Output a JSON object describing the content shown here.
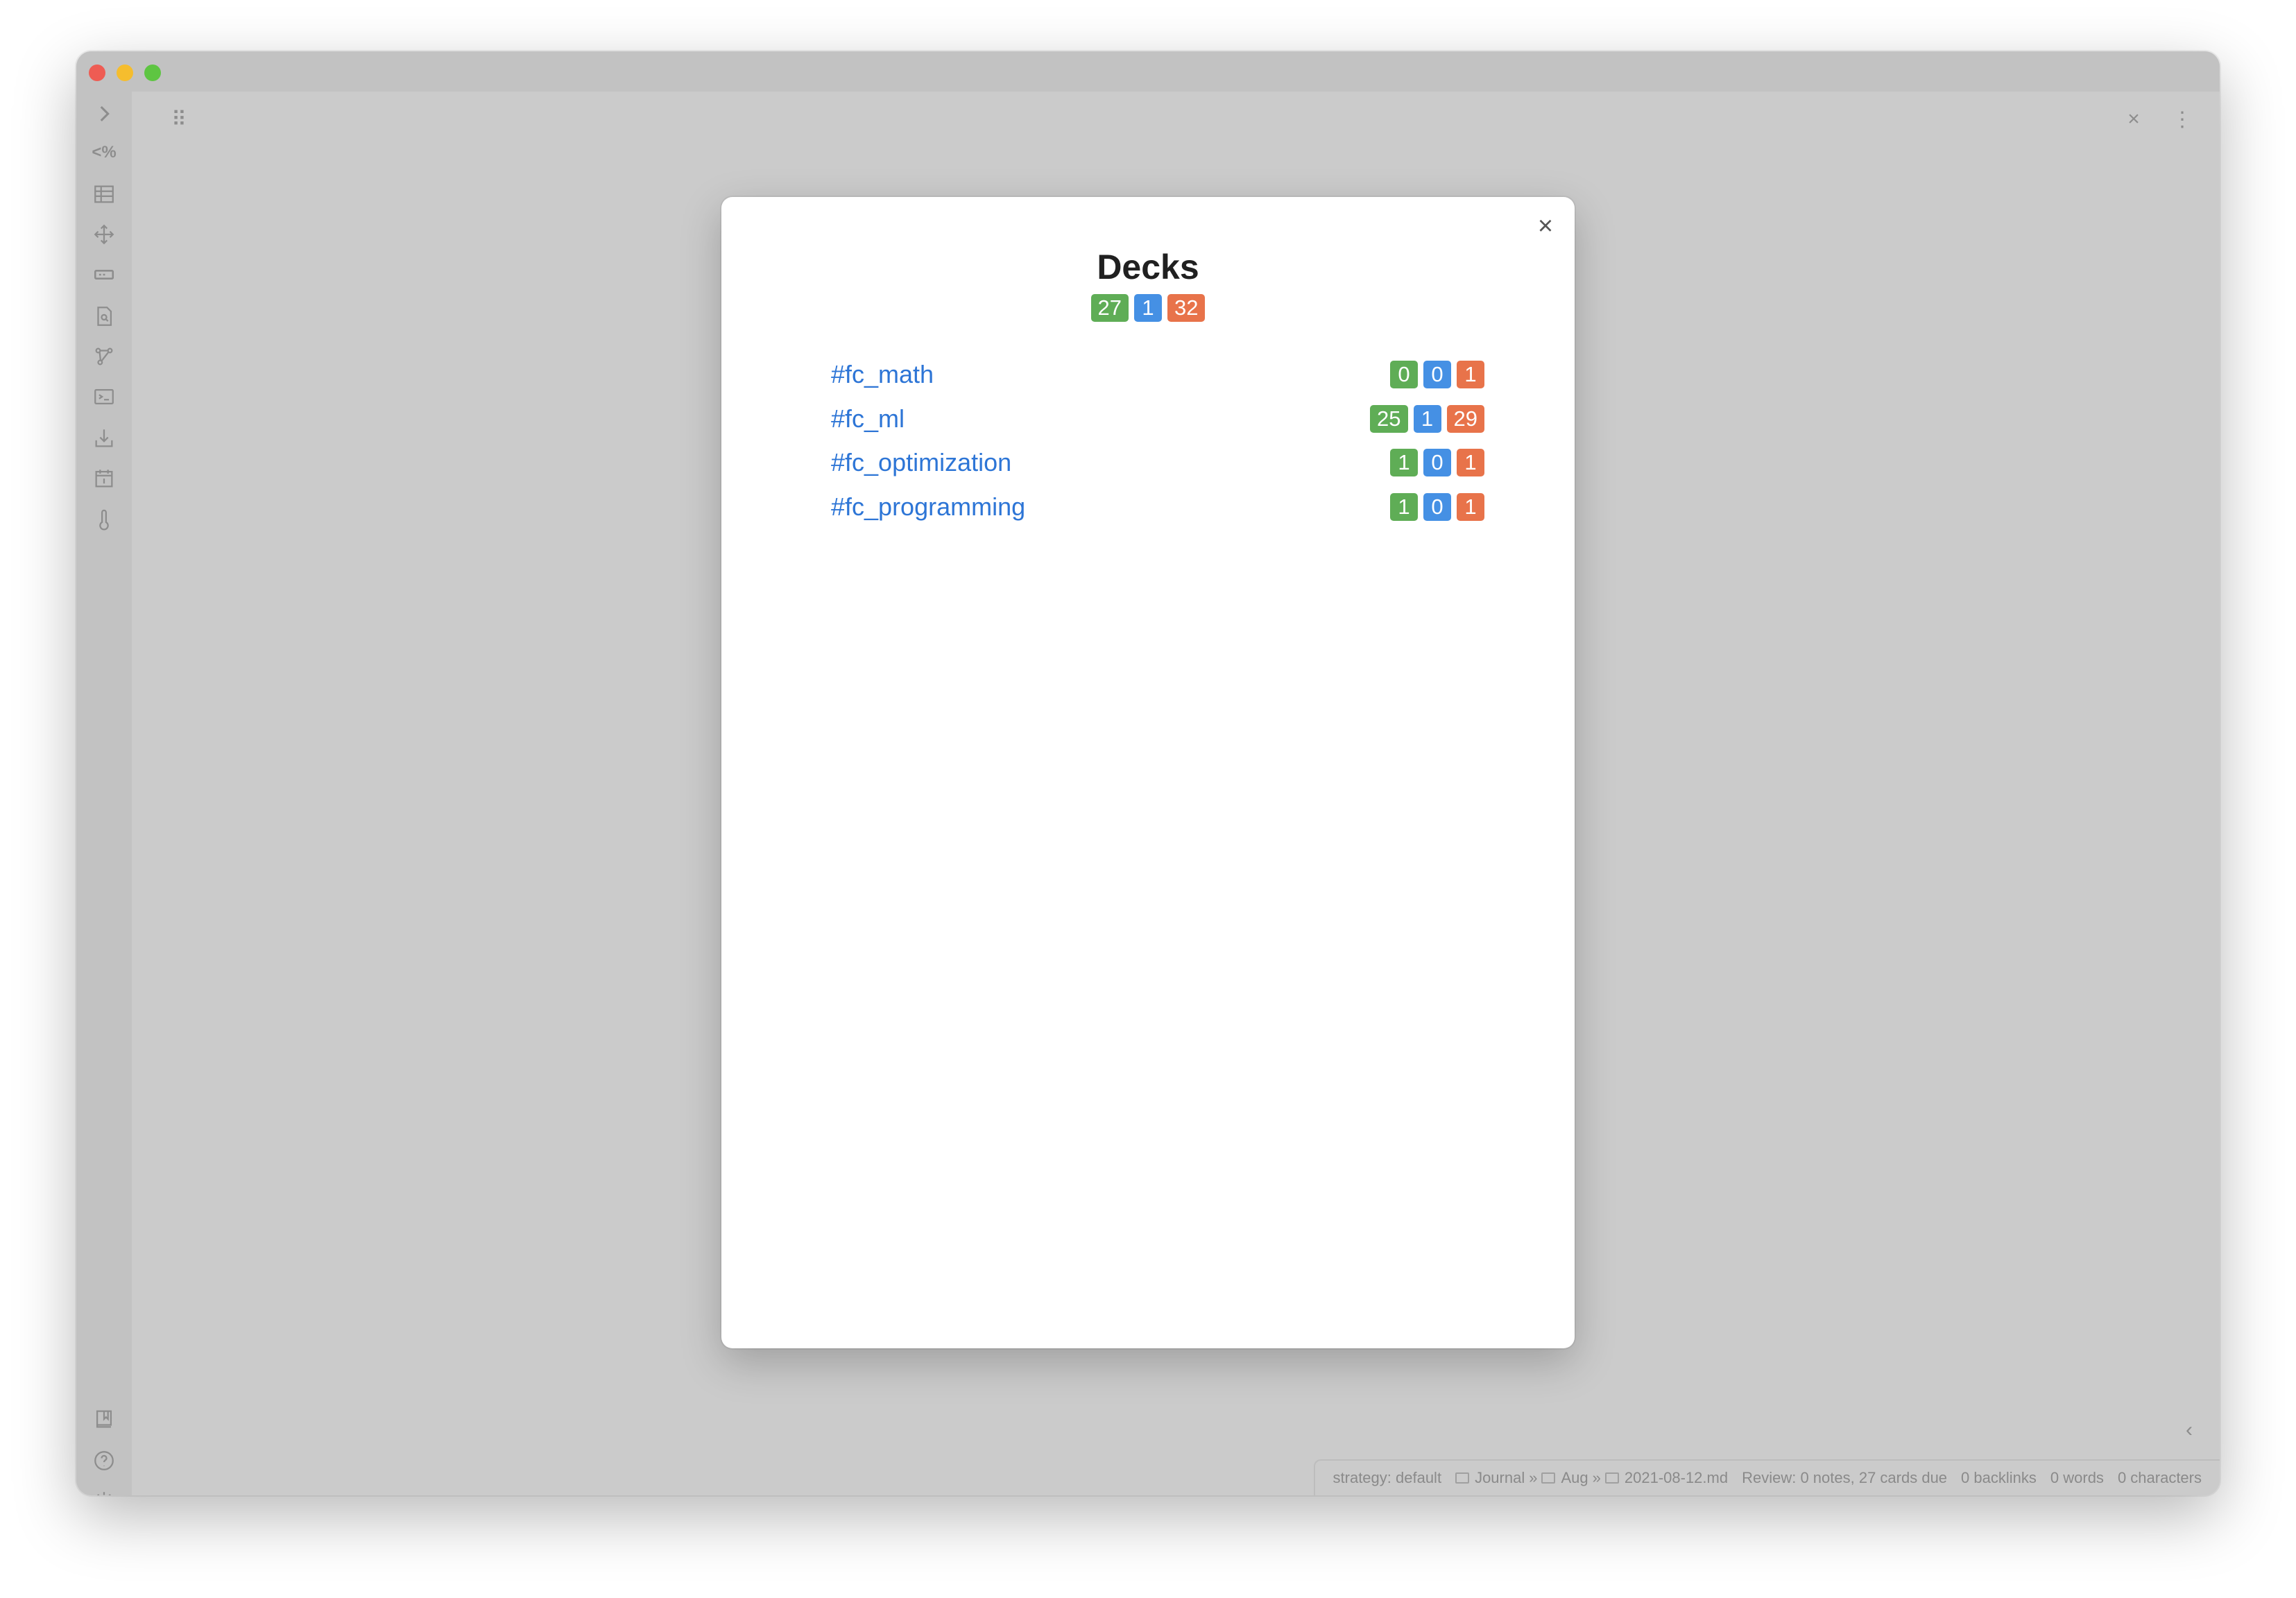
{
  "modal": {
    "title": "Decks",
    "close_glyph": "×",
    "summary": {
      "new": "27",
      "learning": "1",
      "due": "32"
    },
    "decks": [
      {
        "name": "#fc_math",
        "new": "0",
        "learning": "0",
        "due": "1"
      },
      {
        "name": "#fc_ml",
        "new": "25",
        "learning": "1",
        "due": "29"
      },
      {
        "name": "#fc_optimization",
        "new": "1",
        "learning": "0",
        "due": "1"
      },
      {
        "name": "#fc_programming",
        "new": "1",
        "learning": "0",
        "due": "1"
      }
    ]
  },
  "ribbon": {
    "templater_text": "<%"
  },
  "pane_header": {
    "close_glyph": "×",
    "more_glyph": "⋮",
    "grip_glyph": "⠿",
    "collapse_right_glyph": "‹",
    "expand_left_glyph": "›"
  },
  "statusbar": {
    "strategy": "strategy: default",
    "crumb_1": "Journal",
    "crumb_2": "Aug",
    "crumb_3": "2021-08-12.md",
    "crumb_sep": "»",
    "review": "Review: 0 notes, 27 cards due",
    "backlinks": "0 backlinks",
    "words": "0 words",
    "characters": "0 characters"
  },
  "colors": {
    "new": "#5fad56",
    "learning": "#4590e4",
    "due": "#e8734a",
    "link": "#2d75d6"
  }
}
